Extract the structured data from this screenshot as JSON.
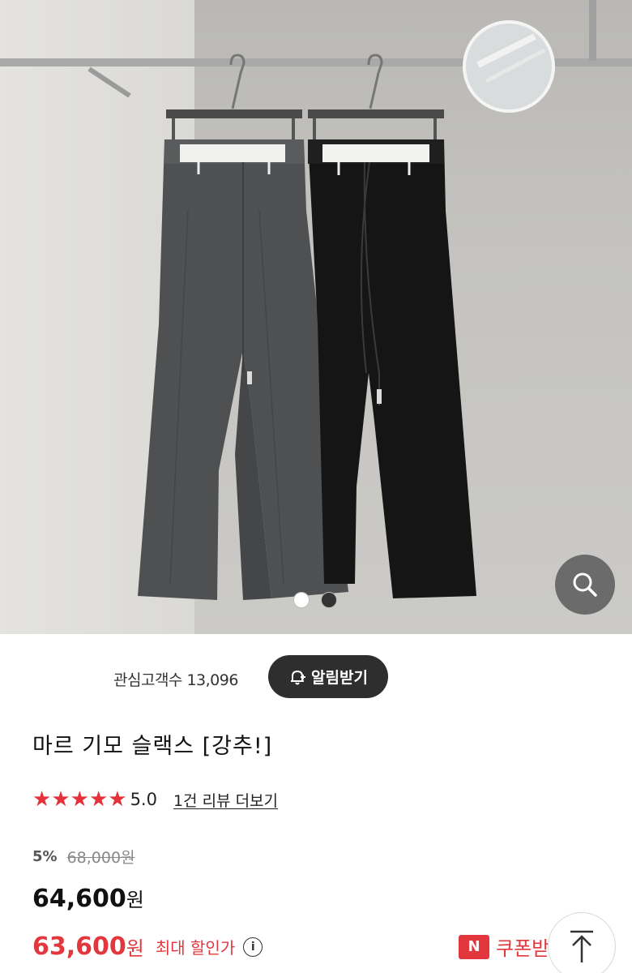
{
  "gallery": {
    "dots": [
      {
        "color": "#ffffff",
        "active": true
      },
      {
        "color": "#333333",
        "active": false
      }
    ],
    "zoom_icon": "search-icon"
  },
  "interest": {
    "label": "관심고객수 13,096",
    "alert_button": "알림받기",
    "alert_icon": "bell-plus-icon"
  },
  "product": {
    "title": "마르 기모 슬랙스 [강추!]",
    "rating": {
      "stars": 5,
      "value": "5.0",
      "review_link": "1건 리뷰 더보기",
      "star_color": "#e5323a"
    },
    "pricing": {
      "discount_rate": "5%",
      "original_price": "68,000원",
      "sale_price": "64,600",
      "sale_unit": "원",
      "coupon_price": "63,600",
      "coupon_unit": "원",
      "max_discount_label": "최대 할인가",
      "accent_color": "#e2373d"
    },
    "coupon": {
      "badge": "N",
      "label": "쿠폰받"
    }
  },
  "floating": {
    "top_icon": "arrow-up-icon"
  }
}
